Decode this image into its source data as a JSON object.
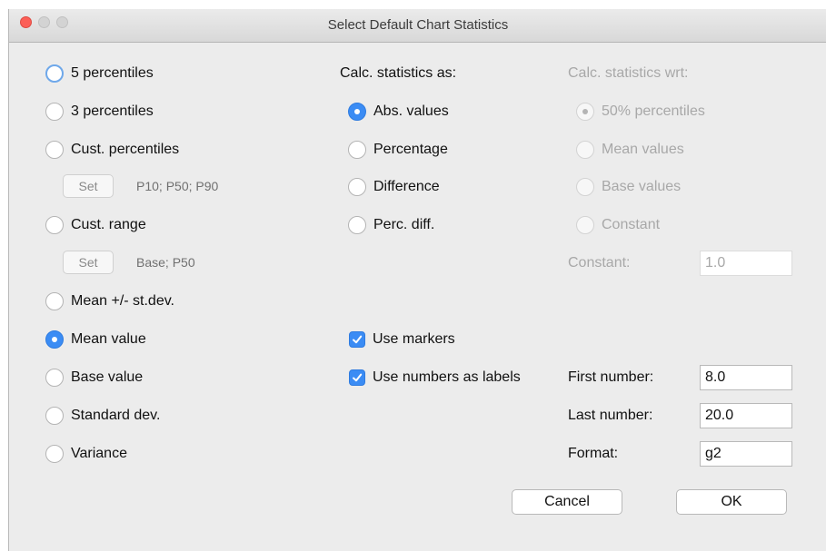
{
  "window": {
    "title": "Select Default Chart Statistics"
  },
  "left_options": [
    {
      "label": "5 percentiles",
      "state": "focus"
    },
    {
      "label": "3 percentiles",
      "state": "off"
    },
    {
      "label": "Cust. percentiles",
      "state": "off"
    },
    {
      "label": "Cust. range",
      "state": "off"
    },
    {
      "label": "Mean +/- st.dev.",
      "state": "off"
    },
    {
      "label": "Mean value",
      "state": "on"
    },
    {
      "label": "Base value",
      "state": "off"
    },
    {
      "label": "Standard dev.",
      "state": "off"
    },
    {
      "label": "Variance",
      "state": "off"
    }
  ],
  "cust_percentiles": {
    "set_label": "Set",
    "value": "P10; P50; P90"
  },
  "cust_range": {
    "set_label": "Set",
    "value": "Base; P50"
  },
  "calc_as": {
    "heading": "Calc. statistics as:",
    "options": [
      {
        "label": "Abs. values",
        "state": "on"
      },
      {
        "label": "Percentage",
        "state": "off"
      },
      {
        "label": "Difference",
        "state": "off"
      },
      {
        "label": "Perc. diff.",
        "state": "off"
      }
    ]
  },
  "calc_wrt": {
    "heading": "Calc. statistics wrt:",
    "options": [
      {
        "label": "50% percentiles",
        "state": "dis-on"
      },
      {
        "label": "Mean values",
        "state": "dis"
      },
      {
        "label": "Base values",
        "state": "dis"
      },
      {
        "label": "Constant",
        "state": "dis"
      }
    ],
    "constant_label": "Constant:",
    "constant_value": "1.0"
  },
  "markers": {
    "use_markers": {
      "label": "Use markers",
      "checked": true
    },
    "use_numbers": {
      "label": "Use numbers as labels",
      "checked": true
    }
  },
  "numbers": {
    "first_label": "First number:",
    "first_value": "8.0",
    "last_label": "Last number:",
    "last_value": "20.0",
    "format_label": "Format:",
    "format_value": "g2"
  },
  "buttons": {
    "cancel": "Cancel",
    "ok": "OK"
  },
  "colors": {
    "accent": "#3b8cf4",
    "close": "#fc5f57"
  }
}
